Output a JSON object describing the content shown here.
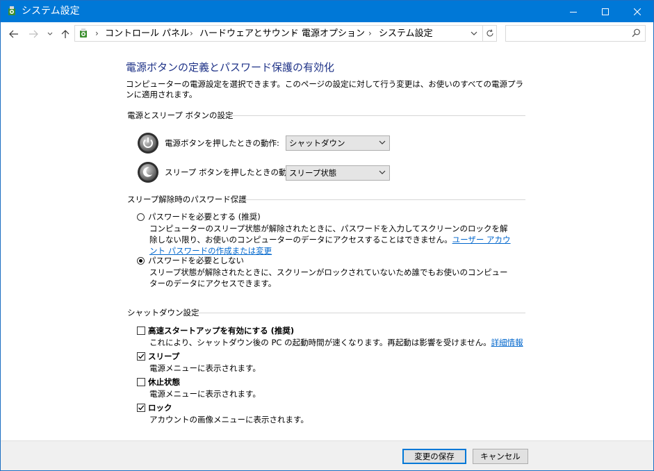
{
  "window": {
    "title": "システム設定",
    "controls": {
      "minimize": "minimize",
      "maximize": "maximize",
      "close": "close"
    },
    "accent": "#0078d7"
  },
  "address": {
    "breadcrumbs": [
      "コントロール パネル",
      "ハードウェアとサウンド",
      "電源オプション",
      "システム設定"
    ],
    "separator": "›",
    "search_placeholder": ""
  },
  "page": {
    "title": "電源ボタンの定義とパスワード保護の有効化",
    "description": "コンピューターの電源設定を選択できます。このページの設定に対して行う変更は、お使いのすべての電源プランに適用されます。",
    "title_color": "#1e3287"
  },
  "buttons_section": {
    "heading": "電源とスリープ ボタンの設定",
    "power_button": {
      "label": "電源ボタンを押したときの動作:",
      "value": "シャットダウン"
    },
    "sleep_button": {
      "label": "スリープ ボタンを押したときの動作:",
      "value": "スリープ状態"
    }
  },
  "password_section": {
    "heading": "スリープ解除時のパスワード保護",
    "options": [
      {
        "label": "パスワードを必要とする (推奨)",
        "desc": "コンピューターのスリープ状態が解除されたときに、パスワードを入力してスクリーンのロックを解除しない限り、お使いのコンピューターのデータにアクセスすることはできません。",
        "link": "ユーザー アカウント パスワードの作成または変更",
        "selected": false
      },
      {
        "label": "パスワードを必要としない",
        "desc": "スリープ状態が解除されたときに、スクリーンがロックされていないため誰でもお使いのコンピューターのデータにアクセスできます。",
        "selected": true
      }
    ]
  },
  "shutdown_section": {
    "heading": "シャットダウン設定",
    "items": [
      {
        "label": "高速スタートアップを有効にする (推奨)",
        "desc": "これにより、シャットダウン後の PC の起動時間が速くなります。再起動は影響を受けません。",
        "link": "詳細情報",
        "checked": false
      },
      {
        "label": "スリープ",
        "desc": "電源メニューに表示されます。",
        "checked": true
      },
      {
        "label": "休止状態",
        "desc": "電源メニューに表示されます。",
        "checked": false
      },
      {
        "label": "ロック",
        "desc": "アカウントの画像メニューに表示されます。",
        "checked": true
      }
    ]
  },
  "footer": {
    "save": "変更の保存",
    "cancel": "キャンセル"
  }
}
